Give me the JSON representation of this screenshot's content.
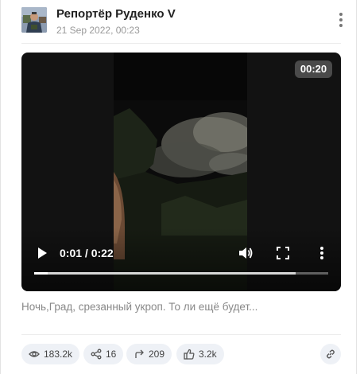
{
  "post": {
    "author": "Репортёр Руденко V",
    "date": "21 Sep 2022, 00:23",
    "avatar_icon": "avatar-photo",
    "menu_icon": "kebab-menu-icon",
    "caption": "Ночь,Град, срезанный укроп. То ли ещё будет..."
  },
  "video": {
    "duration_badge": "00:20",
    "time_display": "0:01 / 0:22",
    "played_fraction": 0.0455,
    "buffered_fraction": 0.89,
    "icons": [
      "play-icon",
      "volume-icon",
      "fullscreen-icon",
      "more-vertical-icon"
    ]
  },
  "stats": {
    "views": "183.2k",
    "shares": "16",
    "forwards": "209",
    "reactions": "3.2k"
  },
  "colors": {
    "stat_background": "#eef1f6",
    "video_background": "#121212",
    "badge_background": "#4a4a4a"
  }
}
